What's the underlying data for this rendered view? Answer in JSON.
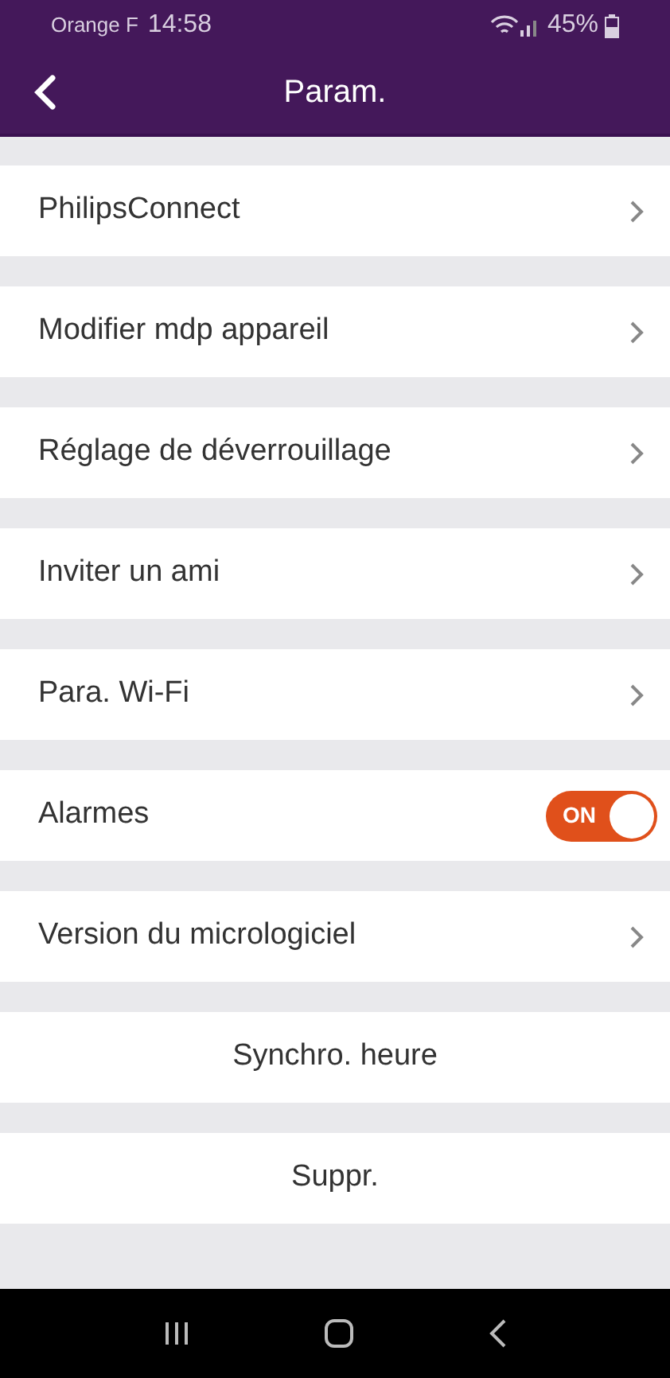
{
  "status_bar": {
    "carrier": "Orange F",
    "time": "14:58",
    "battery": "45%"
  },
  "header": {
    "title": "Param."
  },
  "items": [
    {
      "kind": "link",
      "label": "PhilipsConnect"
    },
    {
      "kind": "link",
      "label": "Modifier mdp appareil"
    },
    {
      "kind": "link",
      "label": "Réglage de déverrouillage"
    },
    {
      "kind": "link",
      "label": "Inviter un ami"
    },
    {
      "kind": "link",
      "label": "Para. Wi-Fi"
    },
    {
      "kind": "toggle",
      "label": "Alarmes",
      "on": true,
      "toggle_text": "ON"
    },
    {
      "kind": "link",
      "label": "Version du micrologiciel"
    },
    {
      "kind": "action",
      "label": "Synchro. heure"
    },
    {
      "kind": "action",
      "label": "Suppr."
    }
  ]
}
